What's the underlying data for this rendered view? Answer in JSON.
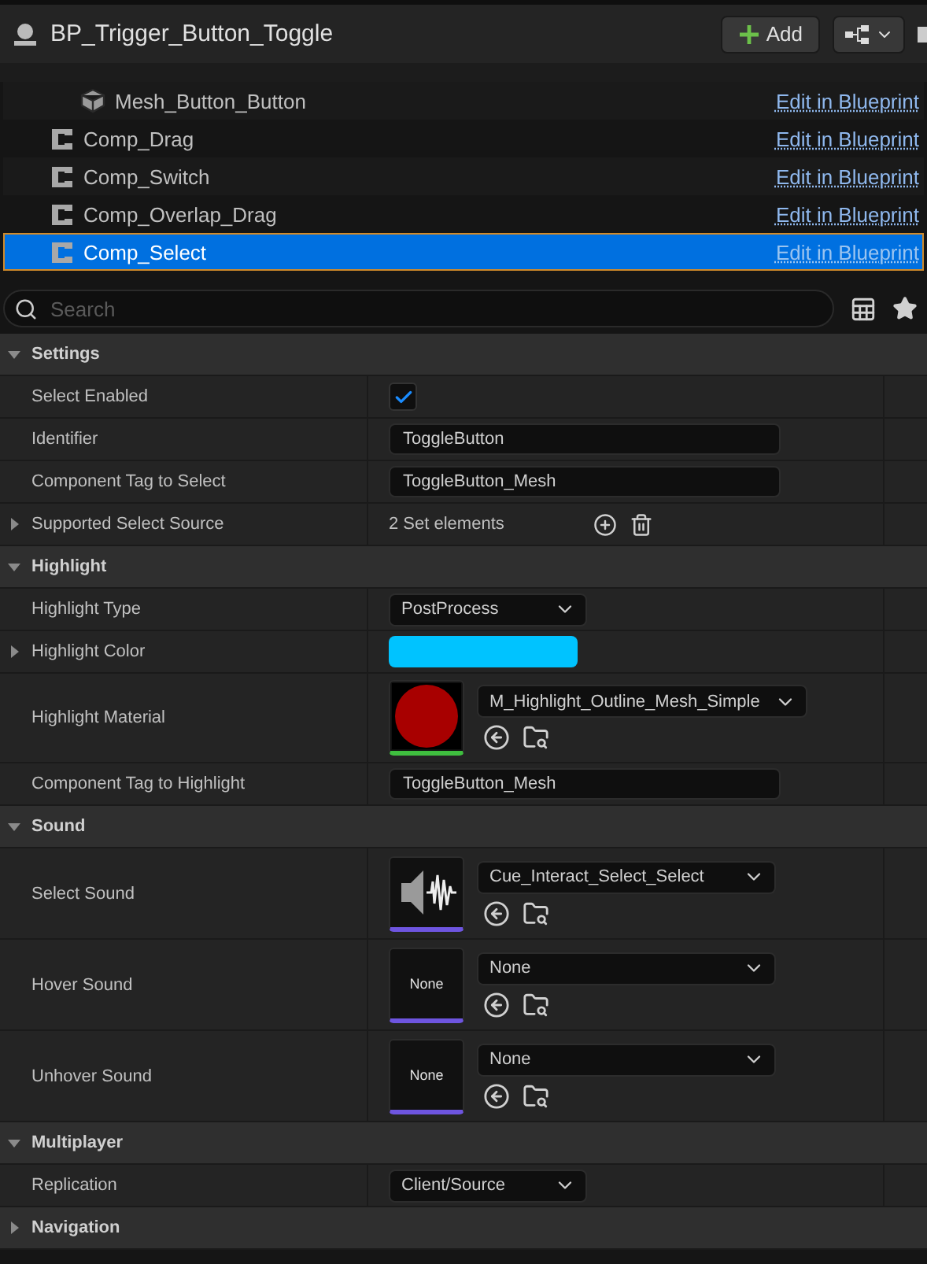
{
  "title": "BP_Trigger_Button_Toggle",
  "add_button": "Add",
  "tree": [
    {
      "label": "Mesh_Button_Button",
      "kind": "mesh",
      "link": "Edit in Blueprint",
      "selected": false
    },
    {
      "label": "Comp_Drag",
      "kind": "component",
      "link": "Edit in Blueprint",
      "selected": false
    },
    {
      "label": "Comp_Switch",
      "kind": "component",
      "link": "Edit in Blueprint",
      "selected": false
    },
    {
      "label": "Comp_Overlap_Drag",
      "kind": "component",
      "link": "Edit in Blueprint",
      "selected": false
    },
    {
      "label": "Comp_Select",
      "kind": "component",
      "link": "Edit in Blueprint",
      "selected": true
    }
  ],
  "search": {
    "placeholder": "Search"
  },
  "sections": [
    {
      "title": "Settings",
      "expanded": true,
      "rows": [
        {
          "label": "Select Enabled",
          "expandable": false,
          "kind": "checkbox",
          "checked": true
        },
        {
          "label": "Identifier",
          "expandable": false,
          "kind": "text",
          "value": "ToggleButton"
        },
        {
          "label": "Component Tag to Select",
          "expandable": false,
          "kind": "text",
          "value": "ToggleButton_Mesh"
        },
        {
          "label": "Supported Select Source",
          "expandable": true,
          "kind": "set",
          "value": "2 Set elements"
        }
      ]
    },
    {
      "title": "Highlight",
      "expanded": true,
      "rows": [
        {
          "label": "Highlight Type",
          "expandable": false,
          "kind": "dropdown",
          "value": "PostProcess"
        },
        {
          "label": "Highlight Color",
          "expandable": true,
          "kind": "color",
          "color": "#00c3ff"
        },
        {
          "label": "Highlight Material",
          "expandable": false,
          "kind": "asset",
          "thumbnail": {
            "kind": "material"
          },
          "value": "M_Highlight_Outline_Mesh_Simple"
        },
        {
          "label": "Component Tag to Highlight",
          "expandable": false,
          "kind": "text",
          "value": "ToggleButton_Mesh"
        }
      ]
    },
    {
      "title": "Sound",
      "expanded": true,
      "rows": [
        {
          "label": "Select Sound",
          "expandable": false,
          "kind": "asset",
          "thumbnail": {
            "kind": "sound"
          },
          "value": "Cue_Interact_Select_Select"
        },
        {
          "label": "Hover Sound",
          "expandable": false,
          "kind": "asset",
          "thumbnail": {
            "kind": "empty",
            "text": "None"
          },
          "value": "None"
        },
        {
          "label": "Unhover Sound",
          "expandable": false,
          "kind": "asset",
          "thumbnail": {
            "kind": "empty",
            "text": "None"
          },
          "value": "None"
        }
      ]
    },
    {
      "title": "Multiplayer",
      "expanded": true,
      "rows": [
        {
          "label": "Replication",
          "expandable": false,
          "kind": "dropdown",
          "value": "Client/Source"
        }
      ]
    },
    {
      "title": "Navigation",
      "expanded": false
    }
  ]
}
